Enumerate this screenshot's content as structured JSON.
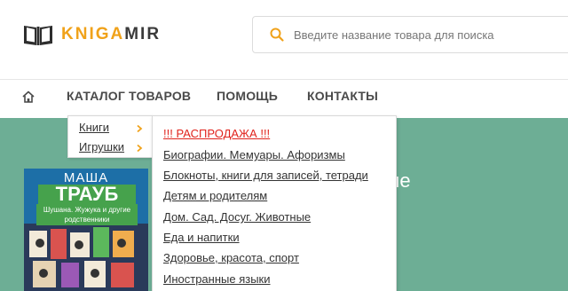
{
  "logo": {
    "part1": "KNIGA",
    "part2": "MIR"
  },
  "search": {
    "placeholder": "Введите название товара для поиска"
  },
  "nav": {
    "catalog": "КАТАЛОГ ТОВАРОВ",
    "help": "ПОМОЩЬ",
    "contacts": "КОНТАКТЫ"
  },
  "catalog_menu": {
    "items": [
      {
        "label": "Книги"
      },
      {
        "label": "Игрушки"
      }
    ]
  },
  "books_submenu": {
    "items": [
      {
        "label": "!!! РАСПРОДАЖА !!!"
      },
      {
        "label": "Биографии. Мемуары. Афоризмы"
      },
      {
        "label": "Блокноты, книги для записей, тетради"
      },
      {
        "label": "Детям и родителям"
      },
      {
        "label": "Дом. Сад. Досуг. Животные"
      },
      {
        "label": "Еда и напитки"
      },
      {
        "label": "Здоровье, красота, спорт"
      },
      {
        "label": "Иностранные языки"
      }
    ]
  },
  "hero": {
    "title_fragment": "гие",
    "book_author": "МАША",
    "book_title": "ТРАУБ",
    "book_subtitle": "Шушана. Жужука и другие родственники"
  },
  "colors": {
    "accent": "#f0a21a",
    "hero_bg": "#6dae95",
    "sale_red": "#e0231c"
  }
}
